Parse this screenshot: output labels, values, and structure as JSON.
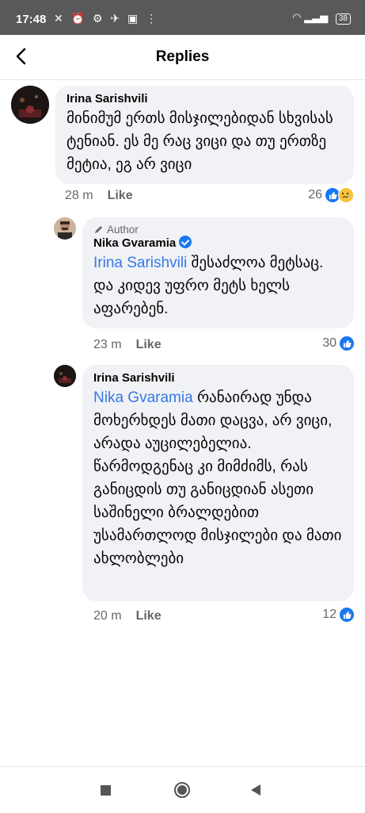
{
  "status_bar": {
    "time": "17:48",
    "battery": "38"
  },
  "header": {
    "title": "Replies"
  },
  "comments": [
    {
      "name": "Irina Sarishvili",
      "text": "მინიმუმ ერთს მისჯილებიდან სხვისას ტენიან. ეს მე რაც ვიცი და თუ ერთზე მეტია, ეგ არ ვიცი",
      "time": "28 m",
      "like_label": "Like",
      "reactions": "26"
    },
    {
      "author_tag": "Author",
      "name": "Nika Gvaramia",
      "mention": "Irina Sarishvili",
      "text": "შესაძლოა მეტსაც. და კიდევ უფრო მეტს ხელს აფარებენ.",
      "time": "23 m",
      "like_label": "Like",
      "reactions": "30"
    },
    {
      "name": "Irina Sarishvili",
      "mention": "Nika Gvaramia",
      "text": "რანაირად უნდა მოხერხდეს მათი დაცვა, არ ვიცი, არადა აუცილებელია. წარმოდგენაც კი მიმძიმს, რას განიცდის თუ განიცდიან ასეთი საშინელი ბრალდებით უსამართლოდ მისჯილები და მათი ახლობლები",
      "time": "20 m",
      "like_label": "Like",
      "reactions": "12"
    }
  ],
  "colors": {
    "accent": "#1877f2",
    "mention": "#3578e5",
    "bubble": "#f0f2f5"
  }
}
